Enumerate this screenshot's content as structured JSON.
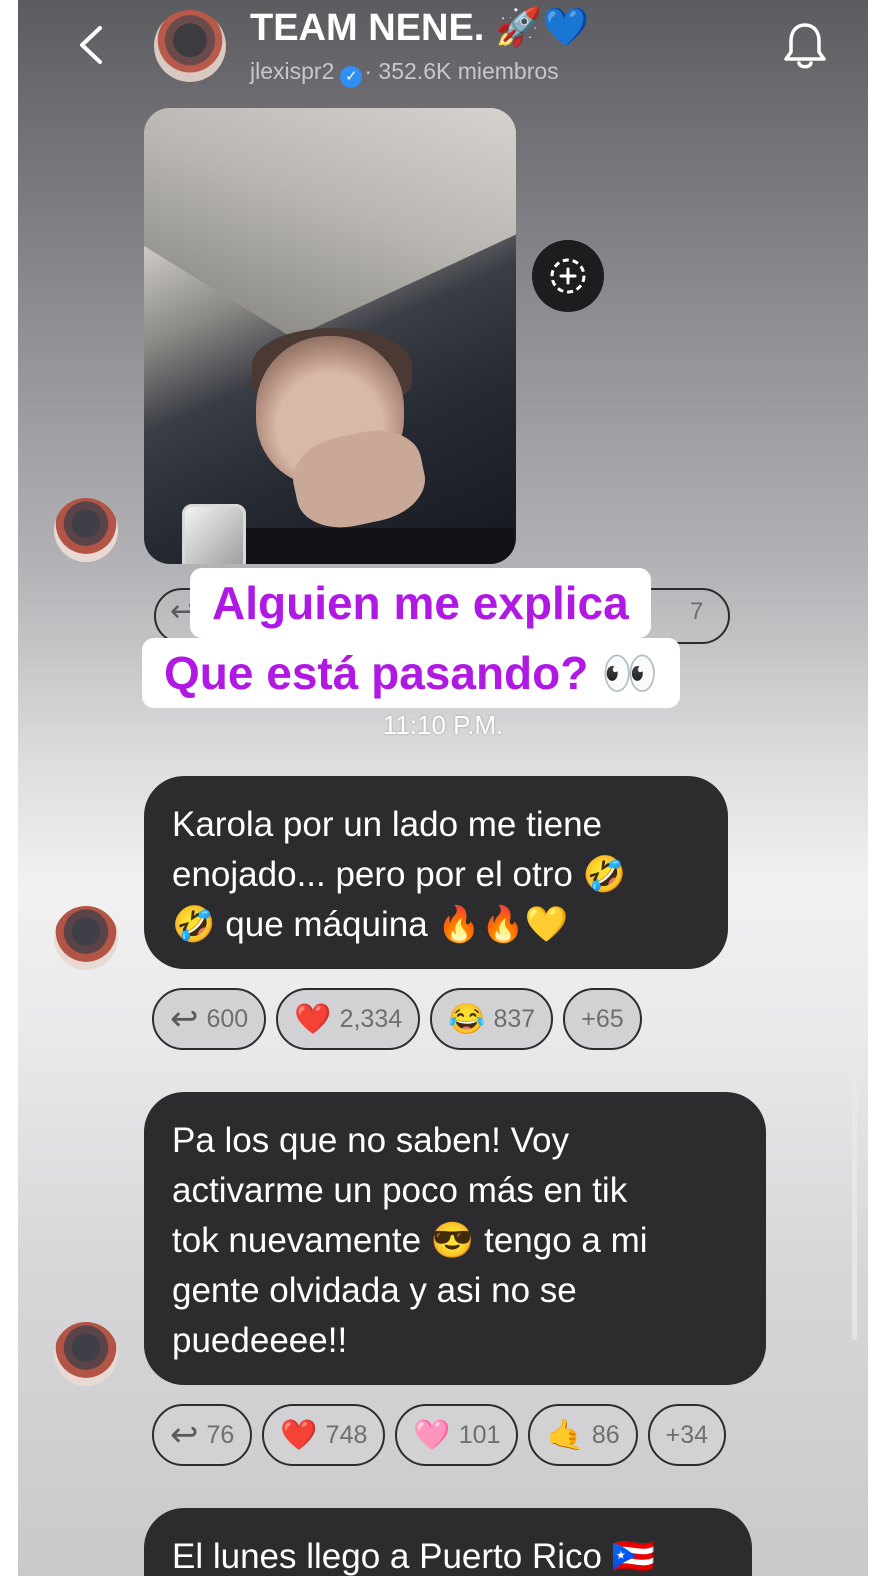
{
  "header": {
    "title": "TEAM NENE. 🚀💙",
    "username": "jlexispr2",
    "verified_glyph": "✓",
    "members": "· 352.6K miembros",
    "back_icon": "chevron-left-icon",
    "bell_icon": "bell-icon"
  },
  "overlay": {
    "line1": "Alguien me explica",
    "line2": "Que está pasando? 👀"
  },
  "hidden_chip_count": "7",
  "timestamp": "11:10 P.M.",
  "messages": [
    {
      "text": "Karola por un lado me tiene\nenojado... pero por el otro 🤣\n🤣 que máquina 🔥🔥💛",
      "reactions": [
        {
          "emoji": "↩",
          "count": "600"
        },
        {
          "emoji": "❤️",
          "count": "2,334"
        },
        {
          "emoji": "😂",
          "count": "837"
        },
        {
          "emoji": "",
          "count": "+65"
        }
      ]
    },
    {
      "text": "Pa los que no saben! Voy\nactivarme un poco más en tik\ntok nuevamente 😎 tengo a mi\ngente olvidada y asi no se\npuedeeee!!",
      "reactions": [
        {
          "emoji": "↩",
          "count": "76"
        },
        {
          "emoji": "❤️",
          "count": "748"
        },
        {
          "emoji": "🩷",
          "count": "101"
        },
        {
          "emoji": "🤙",
          "count": "86"
        },
        {
          "emoji": "",
          "count": "+34"
        }
      ]
    },
    {
      "text": "El lunes llego a Puerto Rico 🇵🇷"
    }
  ],
  "colors": {
    "bubble": "#2c2c2e",
    "overlay_text": "#b019e3",
    "verified": "#2f8ff5"
  }
}
